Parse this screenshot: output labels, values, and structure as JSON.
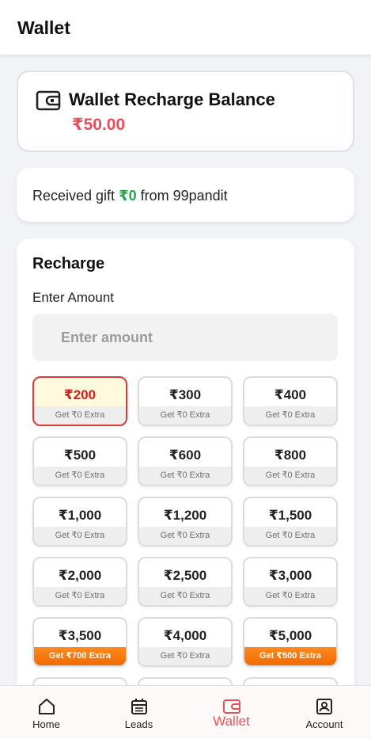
{
  "header": {
    "title": "Wallet"
  },
  "balance": {
    "title": "Wallet Recharge Balance",
    "amount": "₹50.00",
    "icon": "wallet-icon"
  },
  "gift": {
    "prefix": "Received gift ",
    "value": "₹0",
    "suffix": " from 99pandit"
  },
  "recharge": {
    "title": "Recharge",
    "amount_label": "Enter Amount",
    "amount_placeholder": "Enter amount",
    "amount_value": "",
    "options": [
      {
        "amount": "₹200",
        "extra": "Get ₹0 Extra",
        "state": "selected"
      },
      {
        "amount": "₹300",
        "extra": "Get ₹0 Extra",
        "state": "normal"
      },
      {
        "amount": "₹400",
        "extra": "Get ₹0 Extra",
        "state": "normal"
      },
      {
        "amount": "₹500",
        "extra": "Get ₹0 Extra",
        "state": "normal"
      },
      {
        "amount": "₹600",
        "extra": "Get ₹0 Extra",
        "state": "normal"
      },
      {
        "amount": "₹800",
        "extra": "Get ₹0 Extra",
        "state": "normal"
      },
      {
        "amount": "₹1,000",
        "extra": "Get ₹0 Extra",
        "state": "normal"
      },
      {
        "amount": "₹1,200",
        "extra": "Get ₹0 Extra",
        "state": "normal"
      },
      {
        "amount": "₹1,500",
        "extra": "Get ₹0 Extra",
        "state": "normal"
      },
      {
        "amount": "₹2,000",
        "extra": "Get ₹0 Extra",
        "state": "normal"
      },
      {
        "amount": "₹2,500",
        "extra": "Get ₹0 Extra",
        "state": "normal"
      },
      {
        "amount": "₹3,000",
        "extra": "Get ₹0 Extra",
        "state": "normal"
      },
      {
        "amount": "₹3,500",
        "extra": "Get ₹700 Extra",
        "state": "promo"
      },
      {
        "amount": "₹4,000",
        "extra": "Get ₹0 Extra",
        "state": "normal"
      },
      {
        "amount": "₹5,000",
        "extra": "Get ₹500 Extra",
        "state": "promo"
      },
      {
        "amount": "",
        "extra": "",
        "state": "normal"
      },
      {
        "amount": "",
        "extra": "",
        "state": "normal"
      },
      {
        "amount": "",
        "extra": "",
        "state": "normal"
      }
    ]
  },
  "nav": {
    "items": [
      {
        "label": "Home",
        "icon": "home-icon",
        "active": false
      },
      {
        "label": "Leads",
        "icon": "calendar-icon",
        "active": false
      },
      {
        "label": "Wallet",
        "icon": "wallet-icon",
        "active": true
      },
      {
        "label": "Account",
        "icon": "account-icon",
        "active": false
      }
    ]
  },
  "colors": {
    "accent": "#e8505b",
    "gift_green": "#22a447",
    "promo_orange": "#f06a00",
    "selected_border": "#d93a3a"
  }
}
